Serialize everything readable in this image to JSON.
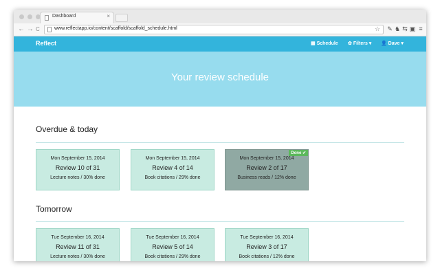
{
  "browser": {
    "tab_title": "Dashboard",
    "tab_close": "×",
    "url": "www.reflectapp.io/content/scaffold/scaffold_schedule.html",
    "back_icon": "←",
    "forward_icon": "→",
    "reload_icon": "C",
    "star_icon": "☆",
    "extensions": [
      "✎",
      "♞",
      "⇆",
      "▣",
      "≡"
    ]
  },
  "nav": {
    "brand": "Reflect",
    "schedule": "Schedule",
    "filters": "Filters",
    "user": "Dave",
    "schedule_icon": "▦",
    "filters_icon": "✿",
    "user_icon": "👤",
    "caret": "▾"
  },
  "hero": {
    "title": "Your review schedule"
  },
  "sections": [
    {
      "title": "Overdue & today",
      "cards": [
        {
          "date": "Mon September 15, 2014",
          "review": "Review 10 of 31",
          "info": "Lecture notes / 30% done"
        },
        {
          "date": "Mon September 15, 2014",
          "review": "Review 4 of 14",
          "info": "Book citations / 29% done"
        },
        {
          "date": "Mon September 15, 2014",
          "review": "Review 2 of 17",
          "info": "Business reads / 12% done",
          "done": "Done ✔"
        }
      ]
    },
    {
      "title": "Tomorrow",
      "cards": [
        {
          "date": "Tue September 16, 2014",
          "review": "Review 11 of 31",
          "info": "Lecture notes / 30% done"
        },
        {
          "date": "Tue September 16, 2014",
          "review": "Review 5 of 14",
          "info": "Book citations / 29% done"
        },
        {
          "date": "Tue September 16, 2014",
          "review": "Review 3 of 17",
          "info": "Book citations / 12% done"
        }
      ]
    }
  ],
  "colors": {
    "nav_bg": "#33b4dc",
    "hero_bg": "#97dcee",
    "card_bg": "#c8ebe1",
    "card_done_bg": "#90a9a3",
    "done_badge": "#5cb85c"
  }
}
